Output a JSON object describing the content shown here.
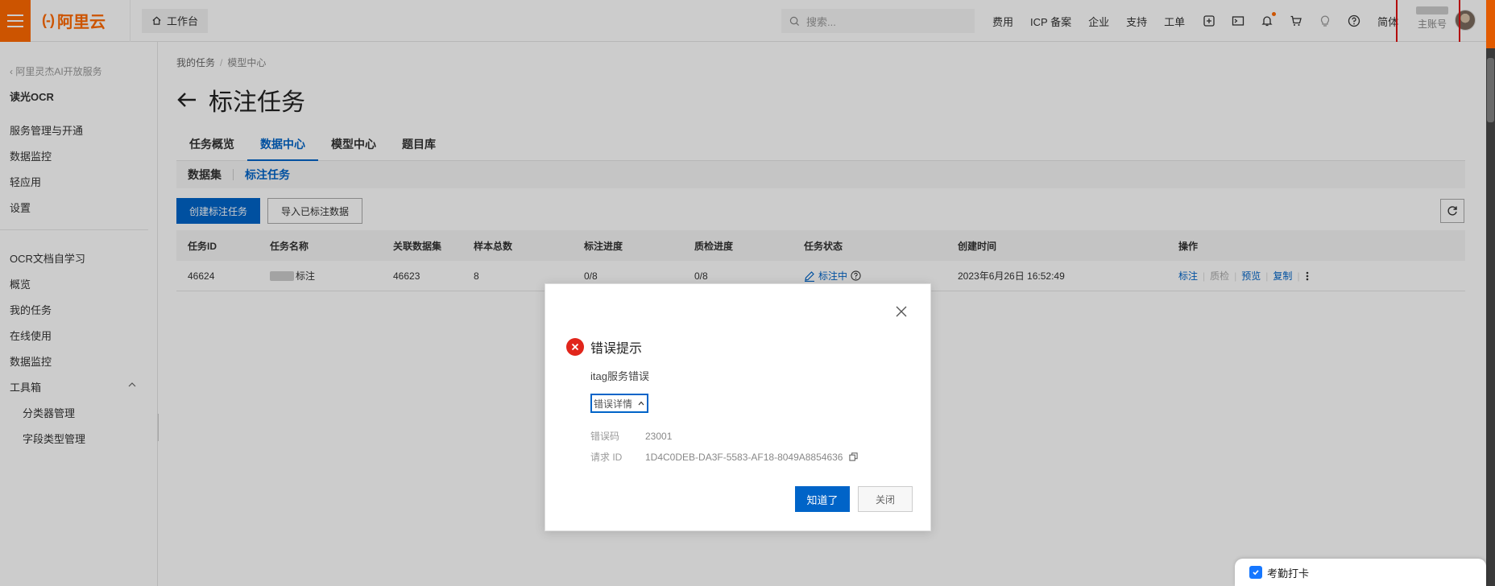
{
  "topbar": {
    "logo_bracket": "(-)",
    "logo_text": "阿里云",
    "workbench": "工作台",
    "search_placeholder": "搜索...",
    "nav": [
      "费用",
      "ICP 备案",
      "企业",
      "支持",
      "工单"
    ],
    "lang": "简体",
    "account_sub": "主账号"
  },
  "sidebar": {
    "back": "阿里灵杰AI开放服务",
    "title": "读光OCR",
    "group1": [
      "服务管理与开通",
      "数据监控",
      "轻应用",
      "设置"
    ],
    "group2": [
      "OCR文档自学习",
      "概览",
      "我的任务",
      "在线使用",
      "数据监控",
      "工具箱"
    ],
    "toolbox_items": [
      "分类器管理",
      "字段类型管理"
    ]
  },
  "main": {
    "breadcrumb": [
      "我的任务",
      "模型中心"
    ],
    "title": "标注任务",
    "tabs": [
      "任务概览",
      "数据中心",
      "模型中心",
      "题目库"
    ],
    "active_tab": "数据中心",
    "subtabs": [
      "数据集",
      "标注任务"
    ],
    "create_button": "创建标注任务",
    "import_button": "导入已标注数据",
    "table": {
      "headers": [
        "任务ID",
        "任务名称",
        "关联数据集",
        "样本总数",
        "标注进度",
        "质检进度",
        "任务状态",
        "创建时间",
        "操作"
      ],
      "rows": [
        {
          "id": "46624",
          "name": "标注",
          "dataset": "46623",
          "total": "8",
          "label_progress": "0/8",
          "qc_progress": "0/8",
          "status": "标注中",
          "created": "2023年6月26日 16:52:49",
          "ops": [
            "标注",
            "质检",
            "预览",
            "复制"
          ]
        }
      ]
    }
  },
  "dialog": {
    "title": "错误提示",
    "message": "itag服务错误",
    "detail_toggle": "错误详情",
    "error_code_label": "错误码",
    "error_code": "23001",
    "request_id_label": "请求 ID",
    "request_id": "1D4C0DEB-DA3F-5583-AF18-8049A8854636",
    "ok": "知道了",
    "close": "关闭"
  },
  "widget": {
    "label": "考勤打卡"
  },
  "colors": {
    "brand": "#ff6a00",
    "primary": "#0064c8",
    "error": "#e1251b"
  }
}
